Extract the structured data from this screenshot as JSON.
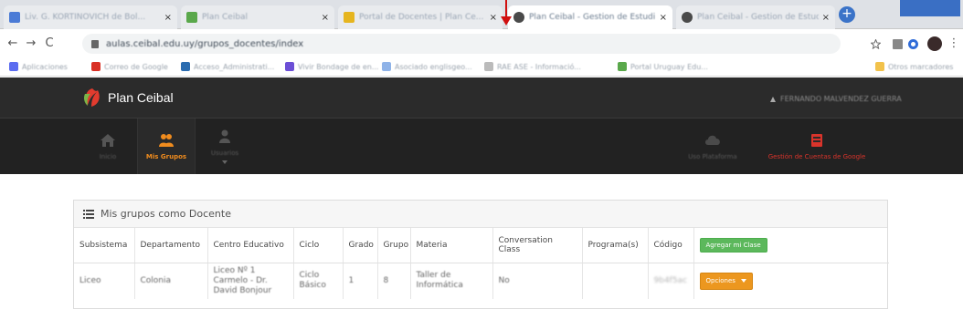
{
  "browser": {
    "tabs": [
      {
        "title": "Liv. G. KORTINOVICH de Bol...",
        "favicon_color": "#4b7bd6"
      },
      {
        "title": "Plan Ceibal",
        "favicon_color": "#5aa84b"
      },
      {
        "title": "Portal de Docentes | Plan Ce...",
        "favicon_color": "#e6b51f"
      },
      {
        "title": "Plan Ceibal - Gestion de Estudi...",
        "favicon_color": "#4a4a4a"
      },
      {
        "title": "Plan Ceibal - Gestion de Estudi...",
        "favicon_color": "#4a4a4a"
      }
    ],
    "tab_close_glyph": "×",
    "new_tab_glyph": "+",
    "url": "aulas.ceibal.edu.uy/grupos_docentes/index",
    "bookmarks": [
      {
        "label": "Aplicaciones",
        "icon_color": "#5b6cf0"
      },
      {
        "label": "Correo de Google",
        "icon_color": "#d93025"
      },
      {
        "label": "Acceso_Administrati...",
        "icon_color": "#2b6cb0"
      },
      {
        "label": "Vivir Bondage de en...",
        "icon_color": "#6c4fd6"
      },
      {
        "label": "Asociado englisgeo...",
        "icon_color": "#8fb3e8"
      },
      {
        "label": "RAE ASE - Informació...",
        "icon_color": "#bbbbbb"
      },
      {
        "label": "Portal Uruguay Edu...",
        "icon_color": "#5aa84b"
      },
      {
        "label": "Otros marcadores",
        "icon_color": "#f2c24b"
      }
    ]
  },
  "site": {
    "brand": "Plan Ceibal",
    "user_name": "FERNANDO MALVENDEZ GUERRA",
    "nav": [
      {
        "label": "Inicio",
        "icon": "home-icon"
      },
      {
        "label": "Mis Grupos",
        "icon": "users-icon"
      },
      {
        "label": "Usuarios",
        "icon": "user-icon"
      },
      {
        "label": "Uso Plataforma",
        "icon": "cloud-icon"
      },
      {
        "label": "Gestión de Cuentas de Google",
        "icon": "google-account-icon"
      }
    ],
    "colors": {
      "accent": "#f08c1e",
      "green": "#5cb85c",
      "orange": "#ec971f",
      "header": "#2b2b2b",
      "red": "#d9342b"
    }
  },
  "panel": {
    "title": "Mis grupos como Docente",
    "columns": [
      "Subsistema",
      "Departamento",
      "Centro Educativo",
      "Ciclo",
      "Grado",
      "Grupo",
      "Materia",
      "Conversation Class",
      "Programa(s)",
      "Código",
      "Agregar mi Clase"
    ],
    "rows": [
      {
        "subsistema": "Liceo",
        "departamento": "Colonia",
        "centro": "Liceo Nº 1 Carmelo - Dr. David Bonjour",
        "ciclo": "Ciclo Básico",
        "grado": "1",
        "grupo": "8",
        "materia": "Taller de Informática",
        "conversation": "No",
        "programas": "",
        "codigo": "9b4f5ac",
        "action_label": "Opciones"
      }
    ]
  }
}
